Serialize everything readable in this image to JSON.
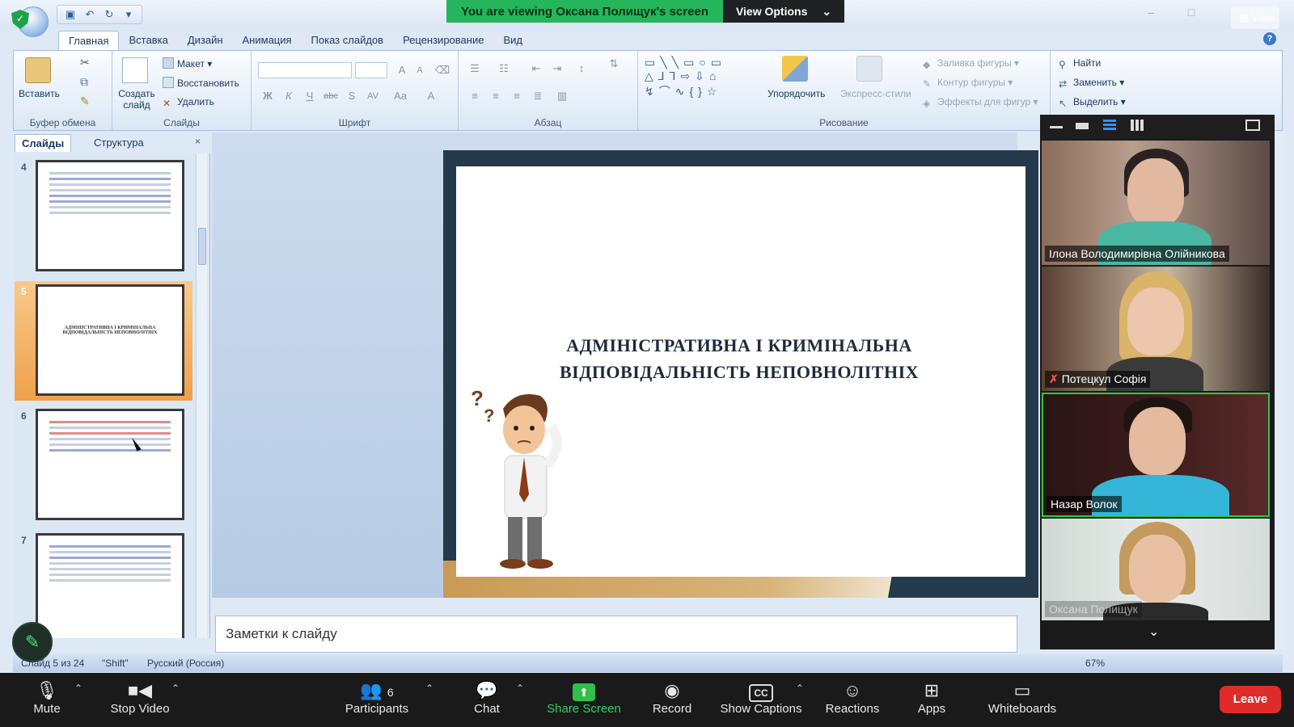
{
  "zoom_banner": {
    "viewing_text": "You are viewing Оксана Полищук's screen",
    "view_options": "View Options",
    "view_button": "View"
  },
  "ppt": {
    "tabs": [
      "Главная",
      "Вставка",
      "Дизайн",
      "Анимация",
      "Показ слайдов",
      "Рецензирование",
      "Вид"
    ],
    "active_tab": "Главная",
    "ribbon": {
      "clipboard": {
        "paste": "Вставить",
        "label": "Буфер обмена"
      },
      "slides": {
        "new_slide": "Создать слайд",
        "layout": "Макет",
        "reset": "Восстановить",
        "delete": "Удалить",
        "label": "Слайды"
      },
      "font": {
        "label": "Шрифт"
      },
      "paragraph": {
        "label": "Абзац"
      },
      "drawing": {
        "arrange": "Упорядочить",
        "quick_styles": "Экспресс-стили",
        "fill": "Заливка фигуры",
        "outline": "Контур фигуры",
        "effects": "Эффекты для фигур",
        "label": "Рисование"
      },
      "editing": {
        "find": "Найти",
        "replace": "Заменить",
        "select": "Выделить"
      }
    },
    "pane_tabs": {
      "slides": "Слайды",
      "outline": "Структура",
      "close": "×"
    },
    "thumbnails": [
      {
        "num": "4",
        "title": ""
      },
      {
        "num": "5",
        "title": "АДМІНІСТРАТИВНА І КРИМІНАЛЬНА ВІДПОВІДАЛЬНІСТЬ НЕПОВНОЛІТНІХ"
      },
      {
        "num": "6",
        "title": ""
      },
      {
        "num": "7",
        "title": ""
      }
    ],
    "slide_title_line1": "АДМІНІСТРАТИВНА І КРИМІНАЛЬНА",
    "slide_title_line2": "ВІДПОВІДАЛЬНІСТЬ НЕПОВНОЛІТНІХ",
    "notes_placeholder": "Заметки к слайду",
    "status": {
      "slide_counter": "Слайд 5 из 24",
      "theme": "\"Shift\"",
      "language": "Русский (Россия)",
      "zoom": "67%"
    }
  },
  "participants_panel": {
    "tiles": [
      {
        "name": "Ілона Володимирівна Олійникова",
        "muted": false,
        "active": false
      },
      {
        "name": "Потецкул Софія",
        "muted": true,
        "active": false
      },
      {
        "name": "Назар Волок",
        "muted": false,
        "active": true
      },
      {
        "name": "Оксана Полищук",
        "muted": false,
        "active": false
      }
    ]
  },
  "toolbar": {
    "mute": "Mute",
    "stop_video": "Stop Video",
    "participants": "Participants",
    "participants_count": "6",
    "chat": "Chat",
    "share_screen": "Share Screen",
    "record": "Record",
    "captions": "Show Captions",
    "captions_icon": "CC",
    "reactions": "Reactions",
    "apps": "Apps",
    "whiteboards": "Whiteboards",
    "leave": "Leave"
  },
  "colors": {
    "zoom_green": "#25b55b",
    "leave_red": "#e02b2b",
    "active_speaker": "#2ecc40"
  }
}
